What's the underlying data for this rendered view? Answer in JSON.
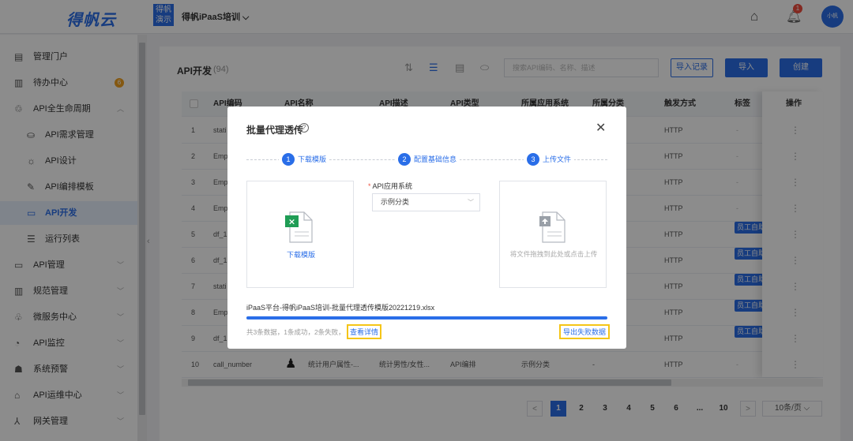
{
  "topbar": {
    "logo": "得帆云",
    "project_icon": "得帆演示",
    "project_name": "得帆iPaaS培训 ⌵",
    "notification_count": "1",
    "avatar": "小帆"
  },
  "sidebar": {
    "items": [
      {
        "label": "管理门户",
        "icon": "portal-icon"
      },
      {
        "label": "待办中心",
        "icon": "todo-icon",
        "badge": "6"
      },
      {
        "label": "API全生命周期",
        "icon": "lifecycle-icon"
      },
      {
        "label": "API需求管理",
        "icon": "requirement-icon"
      },
      {
        "label": "API设计",
        "icon": "design-icon"
      },
      {
        "label": "API编排模板",
        "icon": "orchestration-icon"
      },
      {
        "label": "API开发",
        "icon": "develop-icon"
      },
      {
        "label": "运行列表",
        "icon": "run-list-icon"
      },
      {
        "label": "API管理",
        "icon": "api-manage-icon"
      },
      {
        "label": "规范管理",
        "icon": "spec-icon"
      },
      {
        "label": "微服务中心",
        "icon": "microservice-icon"
      },
      {
        "label": "API监控",
        "icon": "monitor-icon"
      },
      {
        "label": "系统预警",
        "icon": "alert-icon"
      },
      {
        "label": "API运维中心",
        "icon": "ops-icon"
      },
      {
        "label": "网关管理",
        "icon": "gateway-icon"
      }
    ]
  },
  "page": {
    "title": "API开发",
    "count": "(94)",
    "search_placeholder": "搜索API编码、名称、描述",
    "import_log_label": "导入记录",
    "import_label": "导入",
    "create_label": "创建"
  },
  "table": {
    "columns": [
      "API编码",
      "API名称",
      "API描述",
      "API类型",
      "所属应用系统",
      "所属分类",
      "触发方式",
      "标签",
      "操作"
    ],
    "rows": [
      {
        "no": "1",
        "code": "stati",
        "trigger": "HTTP",
        "tag": "-"
      },
      {
        "no": "2",
        "code": "Emp",
        "trigger": "HTTP",
        "tag": "-"
      },
      {
        "no": "3",
        "code": "Emp",
        "trigger": "HTTP",
        "tag": "-"
      },
      {
        "no": "4",
        "code": "Emp",
        "trigger": "HTTP",
        "tag": "-"
      },
      {
        "no": "5",
        "code": "df_1",
        "trigger": "HTTP",
        "tag": "员工自助"
      },
      {
        "no": "6",
        "code": "df_1",
        "trigger": "HTTP",
        "tag": "员工自助"
      },
      {
        "no": "7",
        "code": "stati",
        "trigger": "HTTP",
        "tag": "员工自助"
      },
      {
        "no": "8",
        "code": "Emp",
        "trigger": "HTTP",
        "tag": "员工自助"
      },
      {
        "no": "9",
        "code": "df_1",
        "trigger": "HTTP",
        "tag": "员工自助"
      },
      {
        "no": "10",
        "code": "call_number",
        "name": "统计用户属性-...",
        "desc": "统计男性/女性...",
        "type": "API编排",
        "system": "示例分类",
        "category": "-",
        "trigger": "HTTP",
        "tag": "-"
      }
    ]
  },
  "pagination": {
    "pages": [
      "1",
      "2",
      "3",
      "4",
      "5",
      "6",
      "...",
      "10"
    ],
    "prev": "<",
    "next": ">",
    "page_size": "10条/页 ⌵"
  },
  "modal": {
    "title": "批量代理透传",
    "steps": [
      {
        "num": "1",
        "label": "下载模版"
      },
      {
        "num": "2",
        "label": "配置基础信息"
      },
      {
        "num": "3",
        "label": "上传文件"
      }
    ],
    "download_link": "下载模版",
    "system_label": "API应用系统",
    "system_required_mark": "*",
    "system_value": "示例分类",
    "upload_hint": "将文件拖拽到此处或点击上传",
    "file_name": "iPaaS平台-得帆iPaaS培训-批量代理透传模版20221219.xlsx",
    "progress": 1.0,
    "result_text": "共3条数据，1条成功，2条失败，",
    "view_detail": "查看详情",
    "export_fail": "导出失败数据"
  },
  "colors": {
    "accent": "#2a6ee8",
    "highlight": "#f5c518",
    "badge_orange": "#f0a020",
    "badge_red": "#ee4b3c"
  }
}
